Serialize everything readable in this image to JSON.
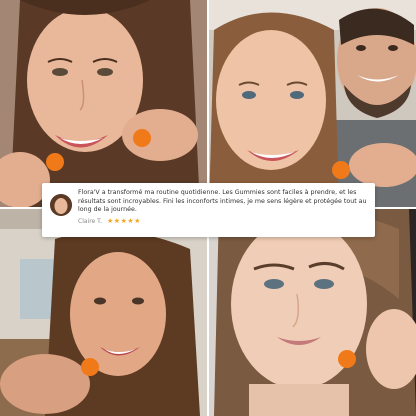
{
  "photos": [
    {
      "subject": "woman with long brown hair smiling holding orange gummy"
    },
    {
      "subject": "smiling woman and bearded man holding orange gummy"
    },
    {
      "subject": "woman with brown hair in living room holding orange gummy"
    },
    {
      "subject": "woman with hair up holding orange gummy"
    }
  ],
  "review": {
    "text": "Flora'V a transformé ma routine quotidienne. Les Gummies sont faciles à prendre, et les résultats sont incroyables. Fini les inconforts intimes, je me sens légère et protégée tout au long de la journée.",
    "author": "Claire T.",
    "rating": 5,
    "stars": [
      "★",
      "★",
      "★",
      "★",
      "★"
    ]
  },
  "colors": {
    "gummy": "#f07a1a",
    "star": "#f5a623",
    "card_bg": "#ffffff",
    "divider": "#ffffff"
  }
}
